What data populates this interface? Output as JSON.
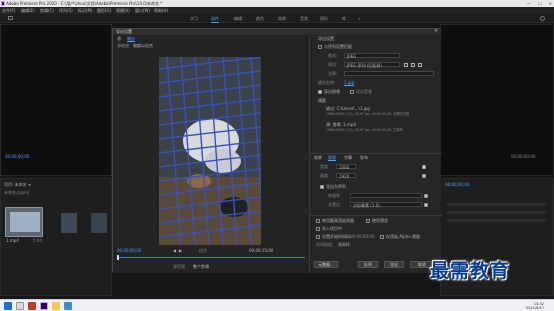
{
  "window": {
    "title": "Adobe Premiere Pro 2020 - C:\\用户\\zhou\\文档\\Adobe\\Premiere Pro\\14.0\\未命名 *",
    "minimize": "—",
    "maximize": "☐",
    "close": "✕"
  },
  "menu": [
    "文件(F)",
    "编辑(E)",
    "剪辑(C)",
    "序列(S)",
    "标记(M)",
    "图形(G)",
    "视图(V)",
    "窗口(W)",
    "帮助(H)"
  ],
  "workspace_tabs": [
    "学习",
    "组件",
    "编辑",
    "颜色",
    "效果",
    "音频",
    "图形",
    "库",
    "»"
  ],
  "workspace_active": 2,
  "left_monitor": {
    "timecode": "00;00;00;00"
  },
  "project_panel": {
    "title": "项目: 未命名 ≡",
    "bin": "未命名.prproj",
    "clip_label": "1.mp4",
    "duration": "5:00"
  },
  "timeline_mini": {
    "timecode": "00;00;00;00"
  },
  "dialog": {
    "title": "导出设置",
    "close": "✕",
    "tabs": [
      "源",
      "输出"
    ],
    "source_scaling_label": "源缩放:",
    "source_scaling_value": "缩放以适合",
    "timecode_in": "00;00;00;00",
    "timecode_out": "00;00;15;00",
    "range_label": "源范围",
    "range_value": "整个剪辑",
    "fit_label": "适合",
    "zoom_label": "源缩放:",
    "zoom_value": "缩放以适合",
    "export_settings": {
      "header": "导出设置",
      "match_sequence": "与序列设置匹配",
      "format_label": "格式:",
      "format_value": "JPEG",
      "preset_label": "预设:",
      "preset_value": "JPEG 序列 (匹配源)",
      "comments_label": "注释:",
      "output_name_label": "输出名称:",
      "output_name_value": "1.jpg",
      "export_video": "导出视频",
      "export_audio": "导出音频",
      "summary_label": "摘要",
      "summary_output": "输出: C:\\Users\\...\\1.jpg",
      "summary_output_detail": "1080x1920 (1.0), 29.97 fps, 00;00;05;00, 无隔行扫描",
      "summary_source": "源: 剪辑, 1.mp4",
      "summary_source_detail": "1080x1920 (1.0), 29.97 fps, 00;00;05;00, 立体声"
    },
    "subtabs": [
      "效果",
      "视频",
      "字幕",
      "发布"
    ],
    "subtab_active": 1,
    "video_section": {
      "fields": [
        "宽度",
        "高度"
      ],
      "width": "1080",
      "height": "1920",
      "sequence_label": "导出为序列",
      "frame_rate_label": "帧速率",
      "field_order_label": "场序",
      "field_order_value": "无场 (逐行扫描)",
      "aspect_label": "长宽比",
      "aspect_value": "方形像素 (1.0)"
    },
    "bottom_options": {
      "max_render": "使用最高渲染质量",
      "use_previews": "使用预览",
      "import_project": "导入项目中",
      "set_start_timecode": "设置开始时间码",
      "timecode_value": "00;00;00;00",
      "render_alpha": "仅渲染 Alpha 通道",
      "time_interp_label": "时间插值:",
      "time_interp_value": "帧采样"
    },
    "buttons": {
      "metadata": "元数据...",
      "queue": "队列",
      "export": "导出",
      "cancel": "取消"
    },
    "fileinfo": "文件大小: 不可用"
  },
  "watermark": "最需教育",
  "taskbar": {
    "time": "15:32",
    "date": "2021/6/17"
  }
}
